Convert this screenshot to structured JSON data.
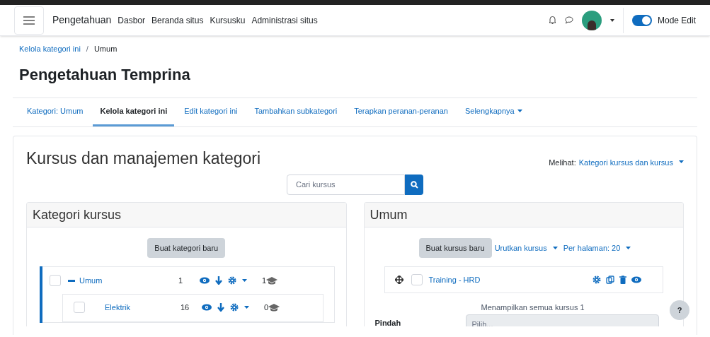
{
  "navbar": {
    "brand": "Pengetahuan",
    "links": [
      "Dasbor",
      "Beranda situs",
      "Kursusku",
      "Administrasi situs"
    ],
    "edit_mode": {
      "label": "Mode Edit",
      "on": true
    }
  },
  "breadcrumb_separator": "/",
  "breadcrumb": [
    {
      "label": "Kelola kategori ini",
      "link": true
    },
    {
      "label": "Umum",
      "link": false
    }
  ],
  "page_title": "Pengetahuan Temprina",
  "tabs": [
    {
      "label": "Kategori: Umum",
      "selected": false,
      "dropdown": false
    },
    {
      "label": "Kelola kategori ini",
      "selected": true,
      "dropdown": false
    },
    {
      "label": "Edit kategori ini",
      "selected": false,
      "dropdown": false
    },
    {
      "label": "Tambahkan subkategori",
      "selected": false,
      "dropdown": false
    },
    {
      "label": "Terapkan peranan-peranan",
      "selected": false,
      "dropdown": false
    },
    {
      "label": "Selengkapnya",
      "selected": false,
      "dropdown": true
    }
  ],
  "main": {
    "heading": "Kursus dan manajemen kategori",
    "view_label": "Melihat:",
    "view_value": "Kategori kursus dan kursus",
    "search": {
      "placeholder": "Cari kursus"
    }
  },
  "categories_panel": {
    "title": "Kategori kursus",
    "button": "Buat kategori baru",
    "tree": [
      {
        "name": "Umum",
        "count": "1",
        "courses": "1",
        "checked": false,
        "expanded": true,
        "children": [
          {
            "name": "Elektrik",
            "count": "16",
            "courses": "0",
            "checked": false
          }
        ]
      }
    ]
  },
  "courses_panel": {
    "title": "Umum",
    "button": "Buat kursus baru",
    "sort": "Urutkan kursus",
    "per_page": "Per halaman: 20",
    "courses": [
      {
        "name": "Training - HRD",
        "checked": false
      }
    ],
    "summary": "Menampilkan semua kursus 1",
    "move_label": "Pindah",
    "move_select": {
      "placeholder": "Pilih..."
    }
  },
  "help_button": "?"
}
